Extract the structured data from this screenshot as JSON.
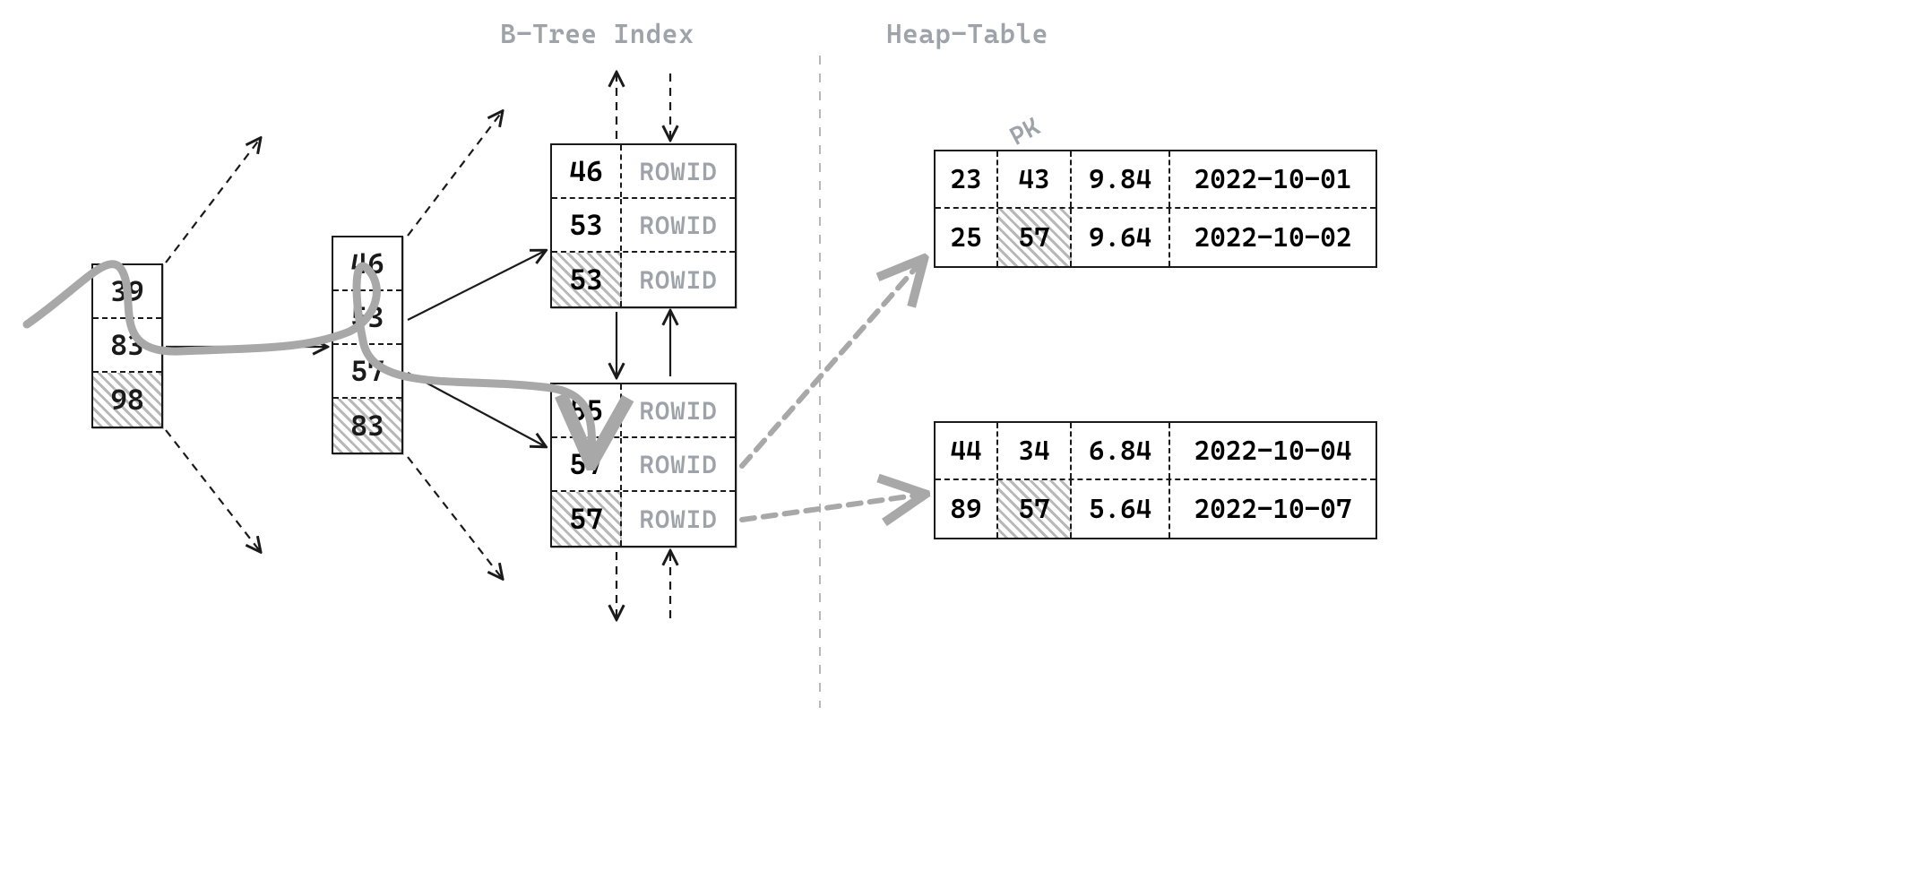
{
  "titles": {
    "btree": "B-Tree Index",
    "heap": "Heap-Table",
    "pk": "PK"
  },
  "btree": {
    "root": {
      "values": [
        39,
        83,
        98
      ],
      "hatched": [
        false,
        false,
        true
      ]
    },
    "branch": {
      "values": [
        46,
        53,
        57,
        83
      ],
      "hatched": [
        false,
        false,
        false,
        true
      ]
    },
    "leaf_upper": {
      "rows": [
        {
          "key": 46,
          "rid": "ROWID",
          "hatched": false
        },
        {
          "key": 53,
          "rid": "ROWID",
          "hatched": false
        },
        {
          "key": 53,
          "rid": "ROWID",
          "hatched": true
        }
      ]
    },
    "leaf_lower": {
      "rows": [
        {
          "key": 55,
          "rid": "ROWID",
          "hatched": false
        },
        {
          "key": 57,
          "rid": "ROWID",
          "hatched": false
        },
        {
          "key": 57,
          "rid": "ROWID",
          "hatched": true
        }
      ]
    }
  },
  "heap": {
    "block_upper": {
      "rows": [
        {
          "c0": 23,
          "c1": 43,
          "c2": "9.84",
          "c3": "2022-10-01",
          "pk_hatched": false
        },
        {
          "c0": 25,
          "c1": 57,
          "c2": "9.64",
          "c3": "2022-10-02",
          "pk_hatched": true
        }
      ]
    },
    "block_lower": {
      "rows": [
        {
          "c0": 44,
          "c1": 34,
          "c2": "6.84",
          "c3": "2022-10-04",
          "pk_hatched": false
        },
        {
          "c0": 89,
          "c1": 57,
          "c2": "5.64",
          "c3": "2022-10-07",
          "pk_hatched": true
        }
      ]
    }
  }
}
